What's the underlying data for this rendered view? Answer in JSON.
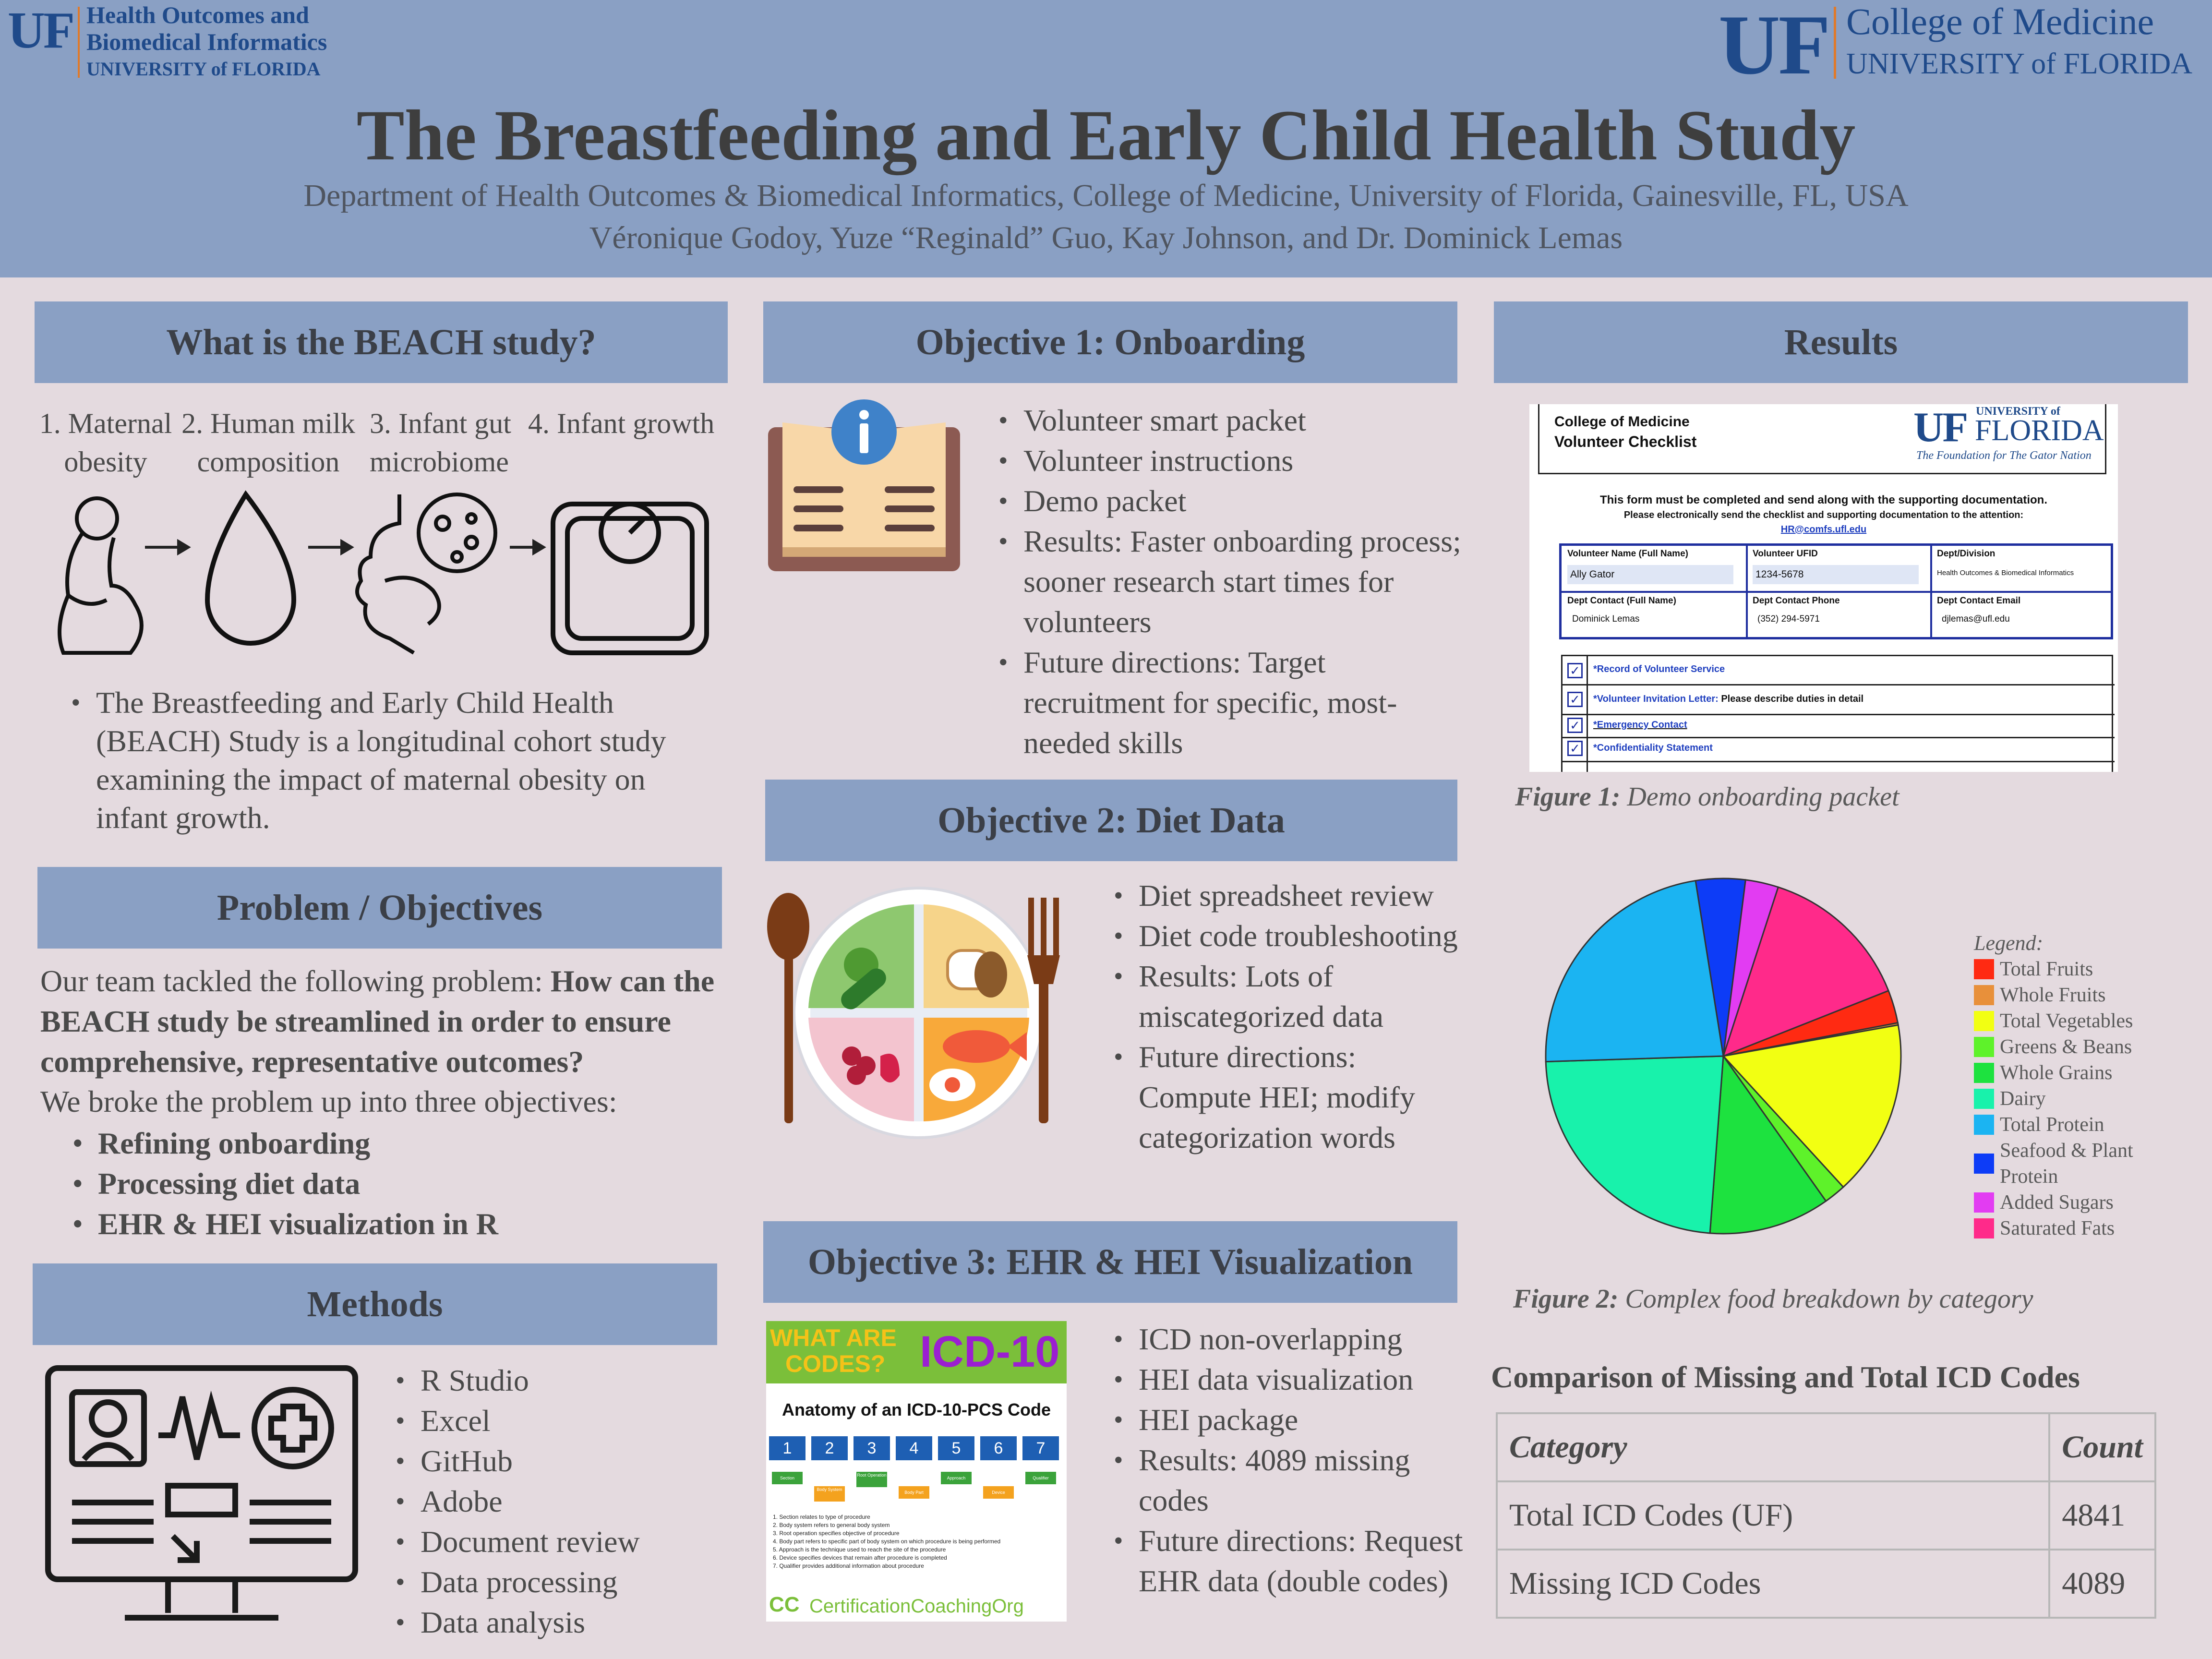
{
  "header": {
    "left_logo": {
      "uf": "UF",
      "line1": "Health Outcomes and",
      "line2": "Biomedical Informatics",
      "line3": "UNIVERSITY of FLORIDA"
    },
    "right_logo": {
      "uf": "UF",
      "line1": "College of Medicine",
      "line2": "UNIVERSITY of FLORIDA"
    },
    "title": "The Breastfeeding and Early Child Health Study",
    "department": "Department of Health Outcomes & Biomedical Informatics, College of Medicine, University of Florida, Gainesville, FL, USA",
    "authors": "Véronique Godoy, Yuze “Reginald” Guo, Kay Johnson, and Dr. Dominick Lemas"
  },
  "beach": {
    "heading": "What is the BEACH study?",
    "steps": [
      {
        "l1": "1. Maternal",
        "l2": "obesity"
      },
      {
        "l1": "2. Human milk",
        "l2": "composition"
      },
      {
        "l1": "3. Infant gut",
        "l2": "microbiome"
      },
      {
        "l1": "4. Infant growth",
        "l2": ""
      }
    ],
    "bullet": "The Breastfeeding and Early Child Health (BEACH) Study is a longitudinal cohort study examining the impact of maternal obesity on infant growth."
  },
  "problem": {
    "heading": "Problem / Objectives",
    "intro": "Our team tackled the following problem:",
    "question": "How can the BEACH study  be streamlined  in order to ensure comprehensive, representative outcomes?",
    "broke": "We broke the problem up into three objectives:",
    "objectives": [
      "Refining onboarding",
      "Processing diet data",
      "EHR & HEI visualization in R"
    ]
  },
  "methods": {
    "heading": "Methods",
    "items": [
      "R Studio",
      "Excel",
      "GitHub",
      "Adobe",
      "Document review",
      "Data processing",
      "Data analysis"
    ]
  },
  "obj1": {
    "heading": "Objective 1: Onboarding",
    "items": [
      "Volunteer smart packet",
      "Volunteer instructions",
      "Demo packet",
      "Results: Faster onboarding process; sooner research start times for volunteers",
      "Future directions: Target recruitment for specific, most-needed skills"
    ]
  },
  "obj2": {
    "heading": "Objective 2: Diet Data",
    "items": [
      "Diet spreadsheet review",
      "Diet code troubleshooting",
      "Results: Lots of miscategorized data",
      "Future directions: Compute HEI; modify categorization words"
    ]
  },
  "obj3": {
    "heading": "Objective 3: EHR & HEI Visualization",
    "items": [
      "ICD non-overlapping",
      "HEI data visualization",
      "HEI package",
      "Results: 4089 missing codes",
      "Future directions: Request EHR data (double codes)"
    ],
    "icd_image": {
      "what_are": "WHAT ARE",
      "codes": "CODES?",
      "icd10": "ICD-10",
      "anatomy": "Anatomy of an ICD-10-PCS Code",
      "numbers": [
        "1",
        "2",
        "3",
        "4",
        "5",
        "6",
        "7"
      ],
      "tags": [
        "Section",
        "Body System",
        "Root Operation",
        "Body Part",
        "Approach",
        "Device",
        "Qualifier"
      ],
      "notes": [
        "1.   Section relates to type of procedure",
        "2.   Body system refers to general body system",
        "3.   Root operation specifies objective of procedure",
        "4.   Body part refers to specific part of body system on which procedure is being performed",
        "5.   Approach is the technique used to reach the site of the procedure",
        "6.   Device specifies devices that remain after procedure is completed",
        "7.   Qualifier provides additional information about procedure"
      ],
      "footer_co": "CC",
      "footer_text": "CertificationCoachingOrg"
    }
  },
  "results": {
    "heading": "Results",
    "form": {
      "org": "College of Medicine",
      "title": "Volunteer Checklist",
      "uf": "UF",
      "univ_small": "UNIVERSITY of",
      "florida": "FLORIDA",
      "tagline": "The Foundation for The Gator Nation",
      "instr1": "This form must be completed and send along with the supporting documentation.",
      "instr2": "Please electronically send the checklist and supporting documentation to the attention:",
      "email_link": "HR@comfs.ufl.edu",
      "fields": [
        {
          "label": "Volunteer Name (Full Name)",
          "value": "Ally Gator"
        },
        {
          "label": "Volunteer UFID",
          "value": "1234-5678"
        },
        {
          "label": "Dept/Division",
          "value": "Health Outcomes & Biomedical Informatics"
        },
        {
          "label": "Dept Contact (Full Name)",
          "value": "Dominick Lemas"
        },
        {
          "label": "Dept Contact Phone",
          "value": "(352) 294-5971"
        },
        {
          "label": "Dept Contact Email",
          "value": "djlemas@ufl.edu"
        }
      ],
      "checks": [
        {
          "link": "*Record of Volunteer Service",
          "rest": ""
        },
        {
          "link": "*Volunteer Invitation Letter:",
          "rest": " Please describe duties in detail"
        },
        {
          "link": "*Emergency Contact",
          "rest": ""
        },
        {
          "link": "*Confidentiality Statement",
          "rest": ""
        }
      ]
    },
    "fig1_label": "Figure 1:",
    "fig1_text": " Demo onboarding packet",
    "fig2_label": "Figure 2:",
    "fig2_text": " Complex food breakdown by category",
    "table_title": "Comparison of Missing and Total ICD Codes",
    "table": {
      "headers": [
        "Category",
        "Count"
      ],
      "rows": [
        [
          "Total ICD Codes (UF)",
          "4841"
        ],
        [
          "Missing ICD Codes",
          "4089"
        ]
      ]
    }
  },
  "chart_data": {
    "type": "pie",
    "title": "",
    "legend_title": "Legend:",
    "legend_position": "right",
    "slices": [
      {
        "name": "Total Fruits",
        "value": 3,
        "color": "#ff2a12"
      },
      {
        "name": "Whole Fruits",
        "value": 0.2,
        "color": "#e8903a"
      },
      {
        "name": "Total Vegetables",
        "value": 16,
        "color": "#f2ff12"
      },
      {
        "name": "Greens & Beans",
        "value": 2,
        "color": "#5ef22a"
      },
      {
        "name": "Whole Grains",
        "value": 11,
        "color": "#1de23f"
      },
      {
        "name": "Dairy",
        "value": 23.3,
        "color": "#18f2ab"
      },
      {
        "name": "Total Protein",
        "value": 23,
        "color": "#1bb4f2"
      },
      {
        "name": "Seafood & Plant Protein",
        "value": 4.5,
        "color": "#0d3cf7"
      },
      {
        "name": "Added Sugars",
        "value": 3,
        "color": "#e23cf2"
      },
      {
        "name": "Saturated Fats",
        "value": 14,
        "color": "#ff2a8a"
      }
    ]
  }
}
